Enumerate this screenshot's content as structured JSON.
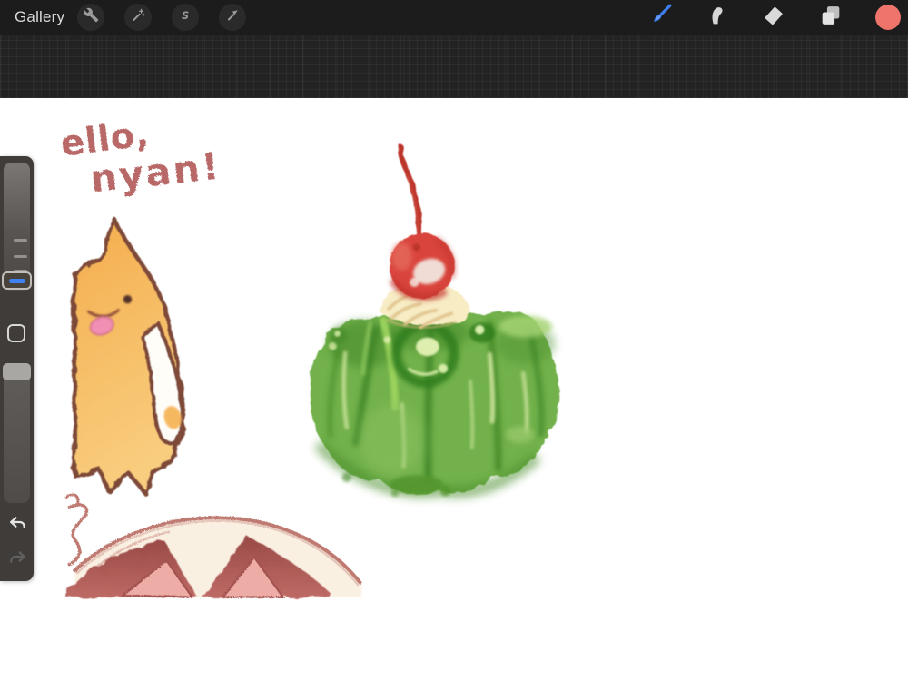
{
  "toolbar": {
    "gallery_label": "Gallery",
    "bar_color": "#1c1c1c",
    "icon_circle_color": "#2a2a2a",
    "icon_glyph_color": "#9b9b9b",
    "left_tools": [
      {
        "icon": "wrench-icon"
      },
      {
        "icon": "magic-wand-icon"
      },
      {
        "icon": "selection-s-icon"
      },
      {
        "icon": "transform-arrow-icon"
      }
    ],
    "right_tools": [
      {
        "icon": "brush-icon",
        "active": true,
        "active_color": "#3d7ef0"
      },
      {
        "icon": "smudge-icon"
      },
      {
        "icon": "eraser-icon"
      },
      {
        "icon": "layers-icon"
      },
      {
        "icon": "color-swatch-circle",
        "color": "#ef746c"
      }
    ],
    "selection_glyph": "S"
  },
  "workspace": {
    "outside_canvas_color": "#232323",
    "canvas_color": "#ffffff"
  },
  "sidebar": {
    "size_slider": {
      "ticks": 3,
      "handle_accent": "#3f80f3"
    },
    "modify_button": {
      "shape": "square-outline"
    },
    "opacity_slider": {
      "handle_color": "#a9a7a3"
    },
    "undo": {
      "enabled": true
    },
    "redo": {
      "enabled": false
    }
  },
  "artwork": {
    "caption_line1": "ello,",
    "caption_line2": "nyan!",
    "caption_color": "#b4615e",
    "palette": {
      "cat_orange": "#f5b054",
      "cat_outline": "#7e4837",
      "jelly_green": "#72b14b",
      "jelly_shadow": "#3c8424",
      "jelly_highlight": "#cde59c",
      "cherry_red": "#d9453d",
      "cream_yellow": "#f7ecc4",
      "ear_maroon": "#b3625e",
      "ear_inner_pink": "#eeaca7",
      "crayon_red": "#bf7a71"
    }
  }
}
